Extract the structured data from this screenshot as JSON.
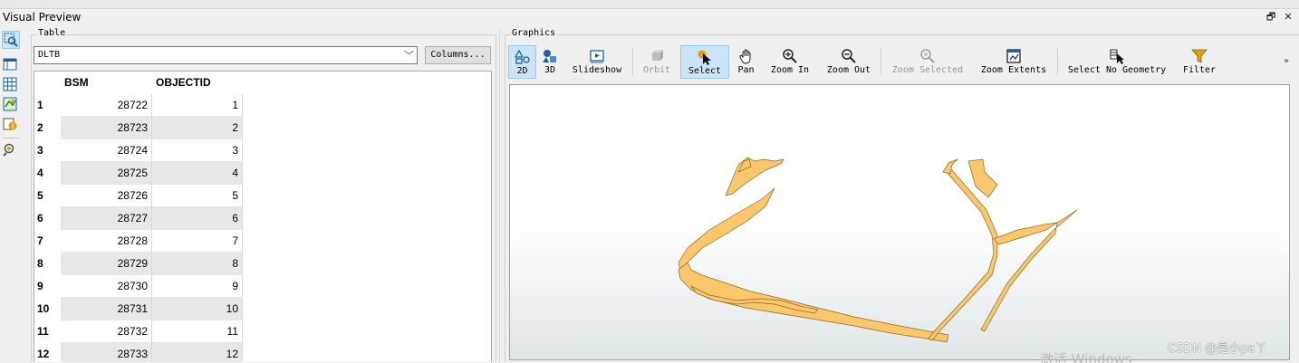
{
  "window": {
    "title": "Visual Preview",
    "restore_glyph": "🗗",
    "close_glyph": "✕"
  },
  "sidebar": {
    "icons": [
      "preview-graphics-icon",
      "table-view-icon",
      "grid-view-icon",
      "map-view-icon",
      "info-icon",
      "identify-icon"
    ]
  },
  "table_panel": {
    "group_label": "Table",
    "layer_select": {
      "value": "DLTB"
    },
    "columns_button": "Columns...",
    "columns": [
      "BSM",
      "OBJECTID"
    ],
    "rows": [
      {
        "n": "1",
        "bsm": "28722",
        "oid": "1"
      },
      {
        "n": "2",
        "bsm": "28723",
        "oid": "2"
      },
      {
        "n": "3",
        "bsm": "28724",
        "oid": "3"
      },
      {
        "n": "4",
        "bsm": "28725",
        "oid": "4"
      },
      {
        "n": "5",
        "bsm": "28726",
        "oid": "5"
      },
      {
        "n": "6",
        "bsm": "28727",
        "oid": "6"
      },
      {
        "n": "7",
        "bsm": "28728",
        "oid": "7"
      },
      {
        "n": "8",
        "bsm": "28729",
        "oid": "8"
      },
      {
        "n": "9",
        "bsm": "28730",
        "oid": "9"
      },
      {
        "n": "10",
        "bsm": "28731",
        "oid": "10"
      },
      {
        "n": "11",
        "bsm": "28732",
        "oid": "11"
      },
      {
        "n": "12",
        "bsm": "28733",
        "oid": "12"
      }
    ]
  },
  "graphics_panel": {
    "group_label": "Graphics",
    "tools": [
      {
        "id": "2d",
        "label": "2D",
        "icon": "2d-shapes-icon",
        "active": true
      },
      {
        "id": "3d",
        "label": "3D",
        "icon": "3d-shapes-icon"
      },
      {
        "id": "slideshow",
        "label": "Slideshow",
        "icon": "slideshow-icon"
      },
      {
        "id": "orbit",
        "label": "Orbit",
        "icon": "orbit-icon",
        "disabled": true
      },
      {
        "id": "select",
        "label": "Select",
        "icon": "select-cursor-icon",
        "active": true
      },
      {
        "id": "pan",
        "label": "Pan",
        "icon": "pan-hand-icon"
      },
      {
        "id": "zoom-in",
        "label": "Zoom In",
        "icon": "zoom-in-icon"
      },
      {
        "id": "zoom-out",
        "label": "Zoom Out",
        "icon": "zoom-out-icon"
      },
      {
        "id": "zoom-selected",
        "label": "Zoom Selected",
        "icon": "zoom-selected-icon",
        "disabled": true
      },
      {
        "id": "zoom-extents",
        "label": "Zoom Extents",
        "icon": "zoom-extents-icon"
      },
      {
        "id": "select-no-geometry",
        "label": "Select No Geometry",
        "icon": "select-no-geometry-icon"
      },
      {
        "id": "filter",
        "label": "Filter",
        "icon": "filter-funnel-icon"
      }
    ],
    "overflow": "»",
    "feature_fill": "#fcc76b",
    "feature_stroke": "#8a6a2a"
  },
  "watermarks": {
    "csdn": "CSDN @是小pa丫",
    "windows": "激活 Windows"
  }
}
